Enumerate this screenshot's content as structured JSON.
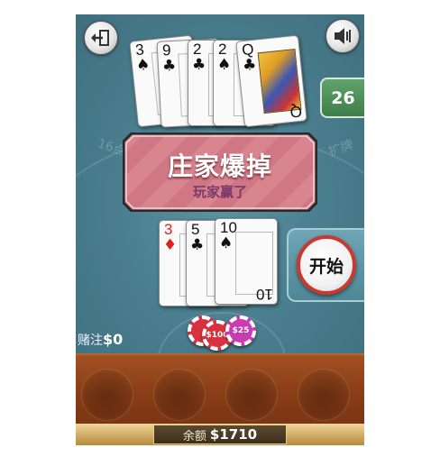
{
  "table": {
    "felt_text_left": "16点",
    "felt_text_right": "扩牌"
  },
  "dealer": {
    "cards": [
      {
        "rank": "3",
        "suit": "♠",
        "color": "black"
      },
      {
        "rank": "9",
        "suit": "♣",
        "color": "black"
      },
      {
        "rank": "2",
        "suit": "♣",
        "color": "black"
      },
      {
        "rank": "2",
        "suit": "♠",
        "color": "black"
      },
      {
        "rank": "Q",
        "suit": "♣",
        "color": "black"
      }
    ]
  },
  "player": {
    "cards": [
      {
        "rank": "3",
        "suit": "♦",
        "color": "red"
      },
      {
        "rank": "5",
        "suit": "♣",
        "color": "black"
      },
      {
        "rank": "10",
        "suit": "♠",
        "color": "black"
      }
    ]
  },
  "deck_count": "26",
  "banner": {
    "title": "庄家爆掉",
    "subtitle": "玩家赢了"
  },
  "start_button": "开始",
  "bet": {
    "label": "赌注",
    "value": "$0"
  },
  "chips": [
    {
      "label": "",
      "color": "#d8323f"
    },
    {
      "label": "$100",
      "color": "#d8323f"
    },
    {
      "label": "$25",
      "color": "#c83bb1"
    }
  ],
  "balance": {
    "label": "余额",
    "value": "$1710"
  },
  "icons": {
    "exit": "exit-icon",
    "sound": "speaker-icon"
  }
}
